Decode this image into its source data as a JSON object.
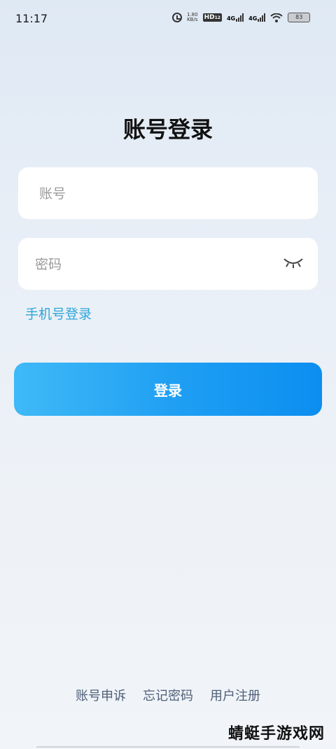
{
  "status_bar": {
    "time": "11:17",
    "net_speed_value": "1.80",
    "net_speed_unit": "KB/s",
    "hd_badge": "HD",
    "hd_sub": "1",
    "hd_sub2": "2",
    "network_1": "4G",
    "network_2": "4G",
    "battery": "83"
  },
  "title": "账号登录",
  "account_field": {
    "placeholder": "账号"
  },
  "password_field": {
    "placeholder": "密码"
  },
  "phone_login_link": "手机号登录",
  "login_button": "登录",
  "footer": {
    "appeal": "账号申诉",
    "forgot_password": "忘记密码",
    "register": "用户注册"
  },
  "watermark": "蜻蜓手游戏网",
  "colors": {
    "accent": "#2fa6d8",
    "button_start": "#3fb9f6",
    "button_end": "#0b8ef0",
    "footer_text": "#4e5f78"
  }
}
